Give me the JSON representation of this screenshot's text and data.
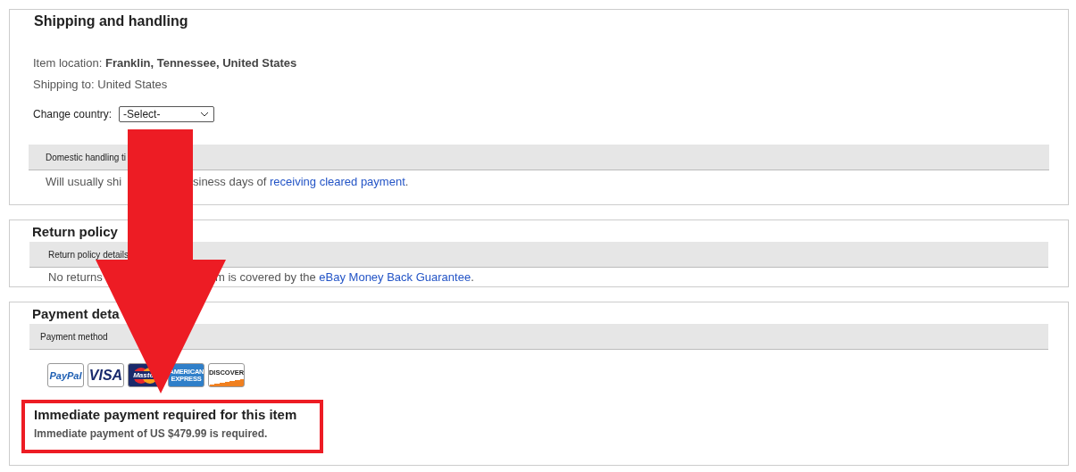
{
  "shipping": {
    "title": "Shipping and handling",
    "item_location": "Item location: **Franklin, Tennessee, United States**",
    "shipping_to": "Shipping to: United States",
    "change_country_label": "Change country:",
    "country_select": {
      "value": "-Select-"
    },
    "handling_header": "Domestic handling ti",
    "handling_before": "Will usually shi",
    "handling_after": "siness days of ",
    "handling_link": "receiving cleared payment",
    "handling_end": "."
  },
  "return_policy": {
    "title": "Return policy",
    "header": "Return policy details",
    "text_before": "No returns",
    "text_after": "m is covered by the ",
    "link": "eBay Money Back Guarantee",
    "end": "."
  },
  "payment": {
    "title": "Payment deta",
    "header": "Payment method",
    "methods": [
      {
        "kind": "paypal",
        "label": "PayPal"
      },
      {
        "kind": "visa",
        "label": "VISA"
      },
      {
        "kind": "mastercard",
        "label": "Maste"
      },
      {
        "kind": "amex",
        "label": "AMERICAN EXPRESS"
      },
      {
        "kind": "discover",
        "label": "DISCOVER"
      }
    ],
    "notice": {
      "highlighted": true,
      "title": "Immediate payment required for this item",
      "text": "Immediate payment of US $479.99 is required."
    }
  },
  "overlay": {
    "kind": "arrow"
  }
}
